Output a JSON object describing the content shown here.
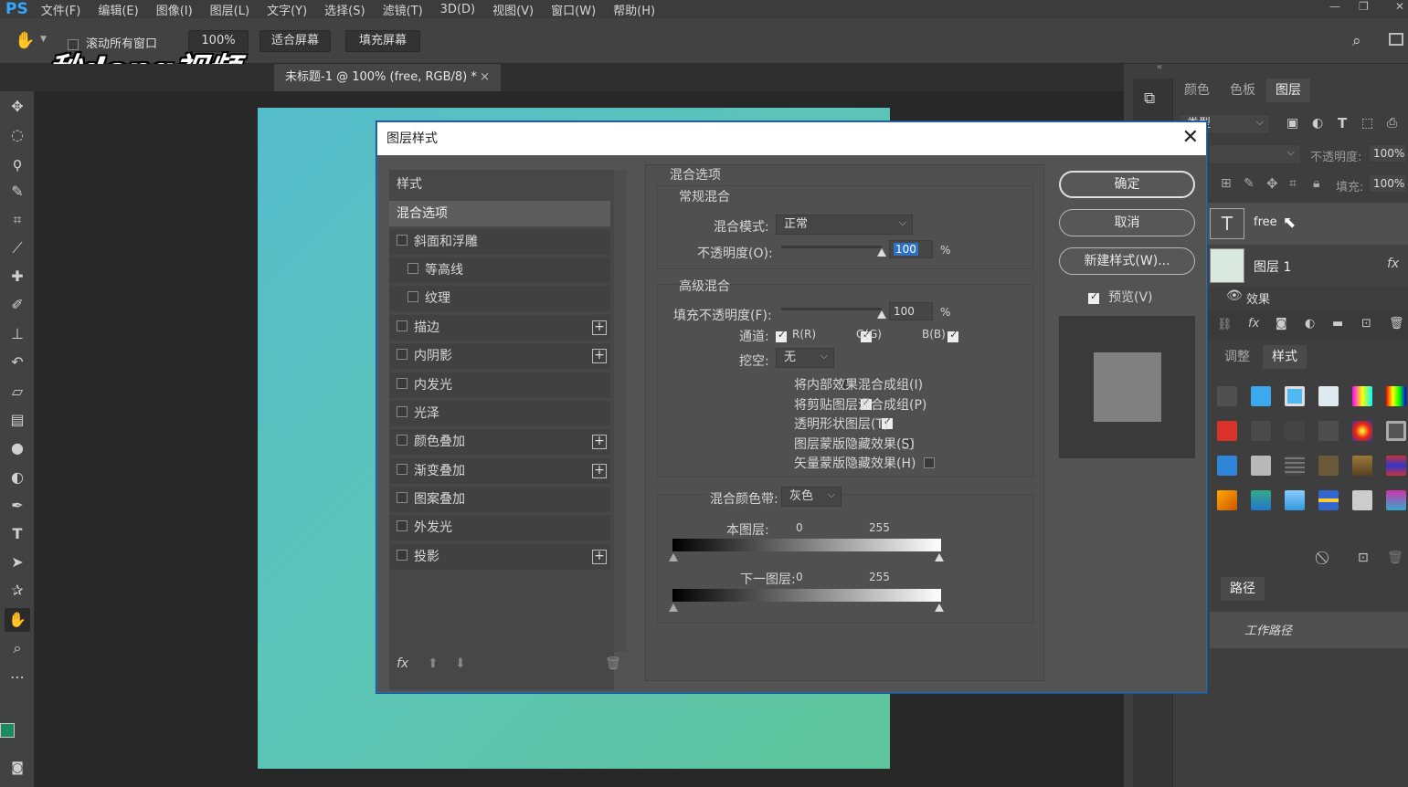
{
  "app": {
    "logo": "PS",
    "menu": [
      "文件(F)",
      "编辑(E)",
      "图像(I)",
      "图层(L)",
      "文字(Y)",
      "选择(S)",
      "滤镜(T)",
      "3D(D)",
      "视图(V)",
      "窗口(W)",
      "帮助(H)"
    ]
  },
  "options_bar": {
    "scroll_all": "滚动所有窗口",
    "zoom": "100%",
    "fit_screen": "适合屏幕",
    "fill_screen": "填充屏幕"
  },
  "watermark": "秒dong视频",
  "document_tab": {
    "title": "未标题-1 @ 100% (free, RGB/8) *",
    "close": "×"
  },
  "panels": {
    "top_tabs": [
      "颜色",
      "色板",
      "图层"
    ],
    "filter_kind": "类型",
    "opacity_label": "不透明度:",
    "opacity_value": "100%",
    "fill_label": "填充:",
    "fill_value": "100%",
    "layers": [
      {
        "name": "free",
        "kind": "text"
      },
      {
        "name": "图层 1",
        "kind": "image",
        "fx": "fx"
      }
    ],
    "effects_label": "效果",
    "adj_tabs": [
      "调整",
      "样式"
    ],
    "paths_tab": "路径",
    "work_path": "工作路径"
  },
  "dialog": {
    "title": "图层样式",
    "list": {
      "header": "样式",
      "items": [
        {
          "label": "混合选项",
          "selected": true,
          "checkbox": false
        },
        {
          "label": "斜面和浮雕",
          "checkbox": true
        },
        {
          "label": "等高线",
          "checkbox": true,
          "indent": true
        },
        {
          "label": "纹理",
          "checkbox": true,
          "indent": true
        },
        {
          "label": "描边",
          "checkbox": true,
          "plus": true
        },
        {
          "label": "内阴影",
          "checkbox": true,
          "plus": true
        },
        {
          "label": "内发光",
          "checkbox": true
        },
        {
          "label": "光泽",
          "checkbox": true
        },
        {
          "label": "颜色叠加",
          "checkbox": true,
          "plus": true
        },
        {
          "label": "渐变叠加",
          "checkbox": true,
          "plus": true
        },
        {
          "label": "图案叠加",
          "checkbox": true
        },
        {
          "label": "外发光",
          "checkbox": true
        },
        {
          "label": "投影",
          "checkbox": true,
          "plus": true
        }
      ],
      "footer_fx": "fx"
    },
    "blend": {
      "section_title": "混合选项",
      "general_title": "常规混合",
      "mode_label": "混合模式:",
      "mode_value": "正常",
      "opacity_label": "不透明度(O):",
      "opacity_value": "100",
      "percent": "%",
      "advanced_title": "高级混合",
      "fill_opacity_label": "填充不透明度(F):",
      "fill_opacity_value": "100",
      "channels_label": "通道:",
      "channels": [
        "R(R)",
        "G(G)",
        "B(B)"
      ],
      "knockout_label": "挖空:",
      "knockout_value": "无",
      "options": [
        {
          "label": "将内部效果混合成组(I)",
          "checked": false
        },
        {
          "label": "将剪贴图层混合成组(P)",
          "checked": true
        },
        {
          "label": "透明形状图层(T)",
          "checked": true
        },
        {
          "label": "图层蒙版隐藏效果(S)",
          "checked": false
        },
        {
          "label": "矢量蒙版隐藏效果(H)",
          "checked": false
        }
      ],
      "blend_if_label": "混合颜色带:",
      "blend_if_value": "灰色",
      "this_layer_label": "本图层:",
      "underlying_label": "下一图层:",
      "range_min": "0",
      "range_max": "255"
    },
    "buttons": {
      "ok": "确定",
      "cancel": "取消",
      "new_style": "新建样式(W)...",
      "preview": "预览(V)"
    }
  }
}
